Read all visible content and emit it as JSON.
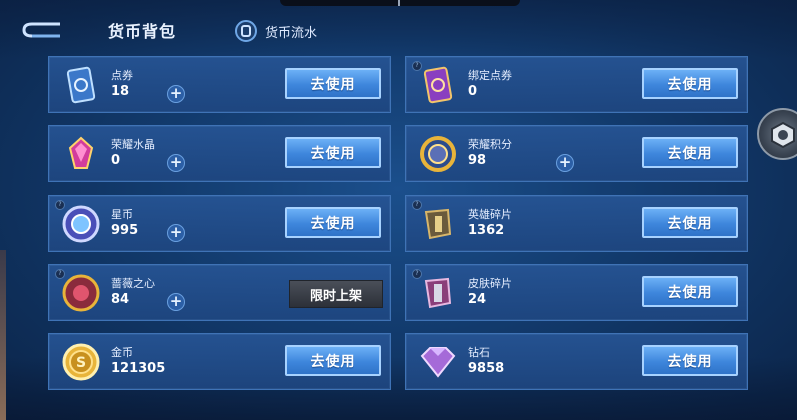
{
  "header": {
    "back_icon": "back-arrow-icon",
    "title": "货币背包",
    "flow_label": "货币流水",
    "flow_icon": "coin-ledger-icon"
  },
  "currencies": [
    {
      "name": "点券",
      "amount": "18",
      "icon": "voucher-card-icon",
      "has_plus": true,
      "has_help": false,
      "action": "去使用"
    },
    {
      "name": "绑定点券",
      "amount": "0",
      "icon": "bound-voucher-card-icon",
      "has_plus": false,
      "has_help": true,
      "action": "去使用"
    },
    {
      "name": "荣耀水晶",
      "amount": "0",
      "icon": "glory-crystal-icon",
      "has_plus": true,
      "has_help": false,
      "action": "去使用"
    },
    {
      "name": "荣耀积分",
      "amount": "98",
      "icon": "glory-points-icon",
      "has_plus": true,
      "has_help": false,
      "action": "去使用"
    },
    {
      "name": "星币",
      "amount": "995",
      "icon": "star-coin-icon",
      "has_plus": true,
      "has_help": true,
      "action": "去使用"
    },
    {
      "name": "英雄碎片",
      "amount": "1362",
      "icon": "hero-fragment-icon",
      "has_plus": false,
      "has_help": true,
      "action": "去使用"
    },
    {
      "name": "蔷薇之心",
      "amount": "84",
      "icon": "rose-heart-icon",
      "has_plus": true,
      "has_help": true,
      "action": "限时上架"
    },
    {
      "name": "皮肤碎片",
      "amount": "24",
      "icon": "skin-fragment-icon",
      "has_plus": false,
      "has_help": true,
      "action": "去使用"
    },
    {
      "name": "金币",
      "amount": "121305",
      "icon": "gold-coin-icon",
      "has_plus": false,
      "has_help": false,
      "action": "去使用"
    },
    {
      "name": "钻石",
      "amount": "9858",
      "icon": "diamond-icon",
      "has_plus": false,
      "has_help": false,
      "action": "去使用"
    }
  ],
  "side_handle_icon": "hexagon-nut-icon",
  "colors": {
    "accent": "#3e86dc",
    "card": "#265494",
    "gold": "#e8b43a",
    "purple": "#a56ad8"
  }
}
